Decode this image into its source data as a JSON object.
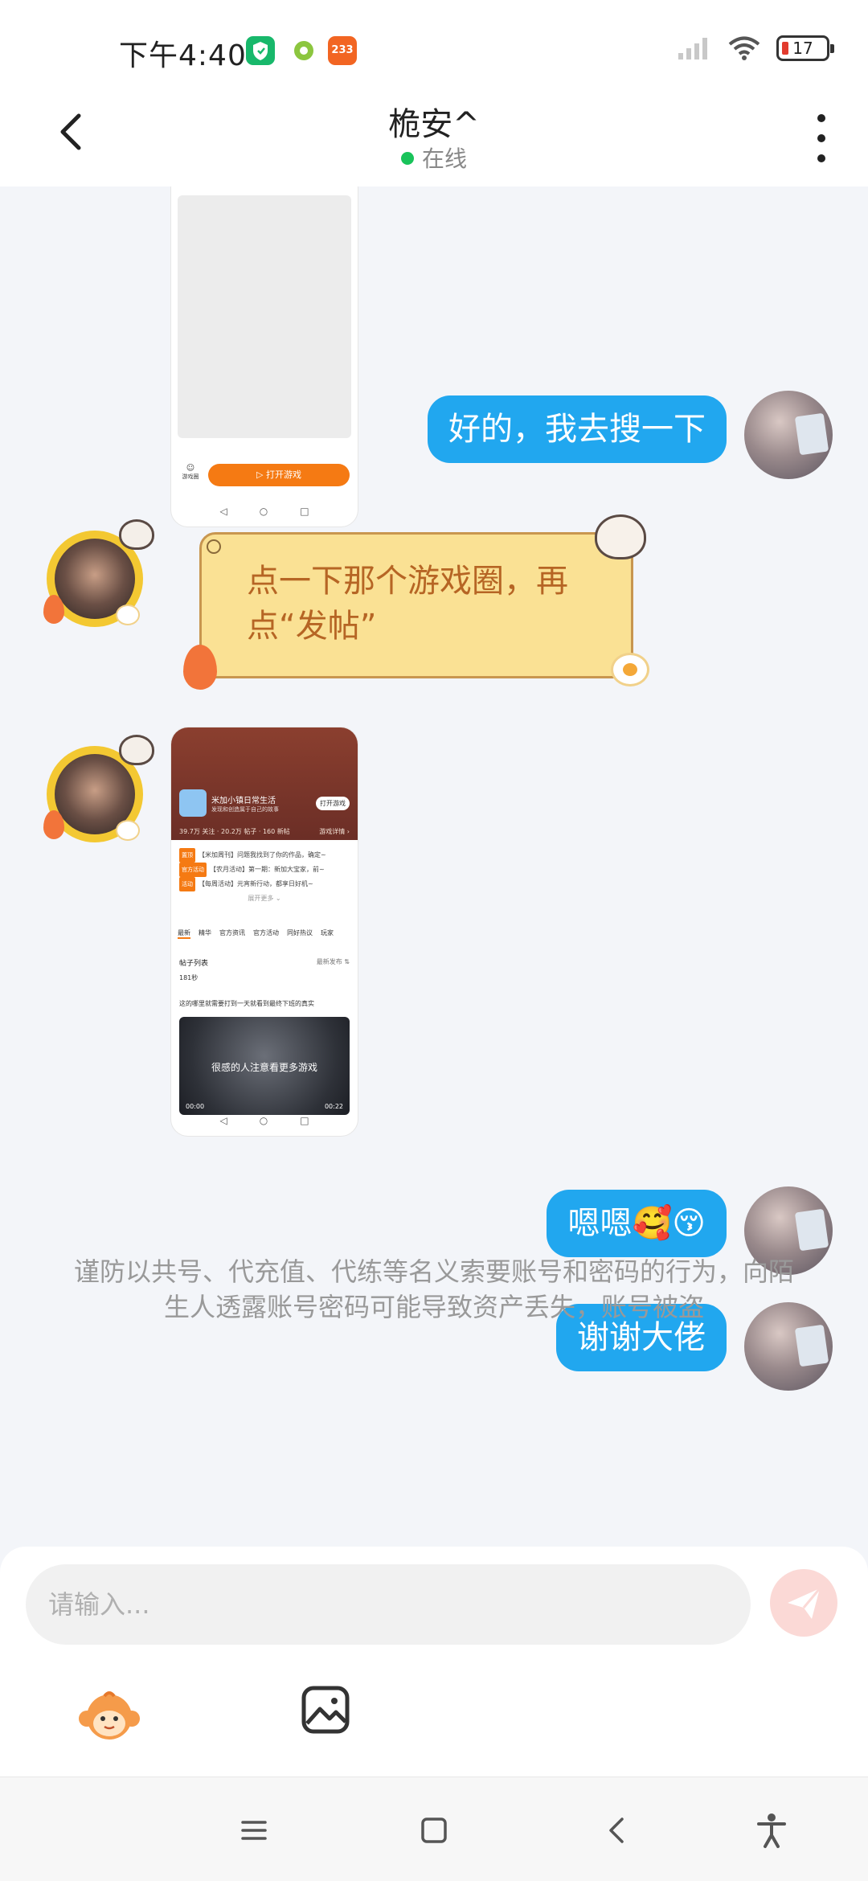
{
  "status_bar": {
    "time": "下午4:40",
    "notification_badge": "233",
    "battery": "17"
  },
  "header": {
    "title": "桅安^",
    "status": "在线"
  },
  "shared_screenshot_1": {
    "button_label": "打开游戏",
    "icon_label": "游戏圈"
  },
  "messages": [
    {
      "from": "me",
      "text": "好的，我去搜一下"
    },
    {
      "from": "other",
      "text": "点一下那个游戏圈，再点“发帖”"
    },
    {
      "from": "me",
      "text": "嗯嗯🥰😚"
    },
    {
      "from": "me",
      "text": "谢谢大佬"
    }
  ],
  "shared_screenshot_2": {
    "game_title": "米加小镇日常生活",
    "game_sub": "发现和创造属于自己的故事",
    "open_btn": "打开游戏",
    "stats": "39.7万 关注 · 20.2万 帖子 · 160 新帖",
    "stats_right": "游戏详情 ›",
    "post1_tag": "置顶",
    "post1": "【米加周刊】问题我找到了你的作品，确定~",
    "post2_tag": "官方活动",
    "post2": "【农月活动】第一期：新加大宝家，前~",
    "post3_tag": "活动",
    "post3": "【每周活动】元宵新行动，都享日好机~",
    "more": "展开更多 ⌄",
    "tabs": [
      "最新",
      "精华",
      "官方资讯",
      "官方活动",
      "同好热议",
      "玩家"
    ],
    "section": "帖子列表",
    "section_right": "最新发布 ⇅",
    "user": "181秒",
    "user_text": "这的哪里就需要打到一天就看到最终下班的真实",
    "video_text": "很感的人注意看更多游戏",
    "video_time_start": "00:00",
    "video_time_end": "00:22"
  },
  "notice": "谨防以共号、代充值、代练等名义索要账号和密码的行为，向陌生人透露账号密码可能导致资产丢失，账号被盗",
  "input": {
    "placeholder": "请输入..."
  },
  "colors": {
    "accent": "#21a7ef",
    "deco_bubble_bg": "#fae194",
    "deco_bubble_text": "#b66524",
    "online": "#19c35a",
    "background": "#f3f5f9"
  }
}
